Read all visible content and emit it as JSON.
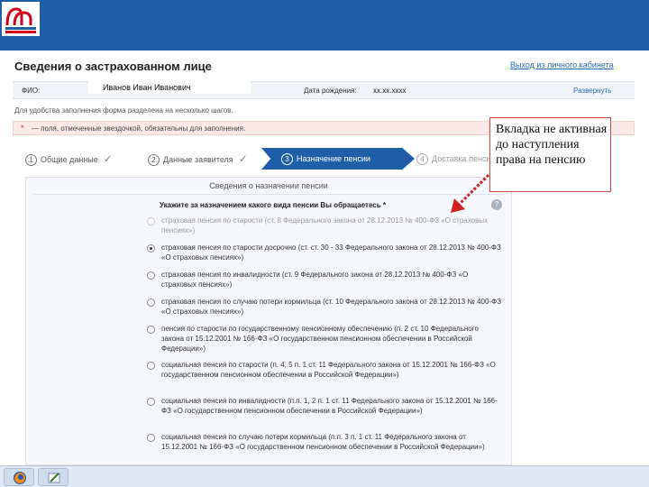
{
  "page": {
    "title": "Сведения о застрахованном лице",
    "logout_link": "Выход из личного кабинета",
    "fio_label": "ФИО:",
    "fio_value": "Иванов Иван Иванович",
    "dob_label": "Дата рождения:",
    "dob_value": "xx.xx.xxxx",
    "expand_link": "Развернуть",
    "info_text": "Для удобства заполнения форма разделена на несколько шагов.",
    "required_star": "*",
    "required_text": "— поля, отмеченные звездочкой, обязательны для заполнения."
  },
  "steps": [
    {
      "num": "1",
      "label": "Общие данные",
      "check": "✓"
    },
    {
      "num": "2",
      "label": "Данные заявителя",
      "check": "✓"
    },
    {
      "num": "3",
      "label": "Назначение пенсии",
      "check": ""
    },
    {
      "num": "4",
      "label": "Доставка пенсии",
      "check": ""
    }
  ],
  "panel": {
    "title": "Сведения о назначении пенсии",
    "question": "Укажите за назначением какого вида пенсии Вы обращаетесь *",
    "help": "?",
    "options": [
      {
        "text": "страховая пенсия по старости (ст. 8 Федерального закона от 28.12.2013 № 400-ФЗ «О страховых пенсиях»)",
        "checked": false,
        "disabled": true
      },
      {
        "text": "страховая пенсия по старости досрочно (ст. ст. 30 - 33 Федерального закона от 28.12.2013 № 400-ФЗ «О страховых пенсиях»)",
        "checked": true,
        "disabled": false
      },
      {
        "text": "страховая пенсия по инвалидности (ст. 9 Федерального закона от 28.12.2013 № 400-ФЗ «О страховых пенсиях»)",
        "checked": false,
        "disabled": false
      },
      {
        "text": "страховая пенсия по случаю потери кормильца (ст. 10 Федерального закона от 28.12.2013 № 400-ФЗ «О страховых пенсиях»)",
        "checked": false,
        "disabled": false
      },
      {
        "text": "пенсия по старости по государственному пенсионному обеспечению (п. 2 ст. 10 Федерального закона от 15.12.2001 № 166-ФЗ «О государственном пенсионном обеспечении в Российской Федерации»)",
        "checked": false,
        "disabled": false
      },
      {
        "text": "социальная пенсия по старости (п. 4, 5 п. 1 ст. 11 Федерального закона от 15.12.2001 № 166-ФЗ «О государственном пенсионном обеспечении в Российской Федерации»)",
        "checked": false,
        "disabled": false
      },
      {
        "text": "социальная пенсия по инвалидности (п.п. 1, 2 п. 1 ст. 11 Федерального закона от 15.12.2001 № 166-ФЗ «О государственном пенсионном обеспечении в Российской Федерации»)",
        "checked": false,
        "disabled": false
      },
      {
        "text": "социальная пенсия по случаю потери кормильца (п.п. 3 п. 1 ст. 11 Федерального закона от 15.12.2001 № 166-ФЗ «О государственном пенсионном обеспечении в Российской Федерации»)",
        "checked": false,
        "disabled": false
      }
    ]
  },
  "callout": {
    "text": "Вкладка не активная до наступления права на пенсию"
  },
  "taskbar": {
    "items": [
      "firefox-icon",
      "pen-icon"
    ]
  },
  "colors": {
    "header": "#1f5fa8",
    "accent": "#1f5fa8",
    "callout_border": "#cc4444",
    "arrow": "#cc2222"
  }
}
